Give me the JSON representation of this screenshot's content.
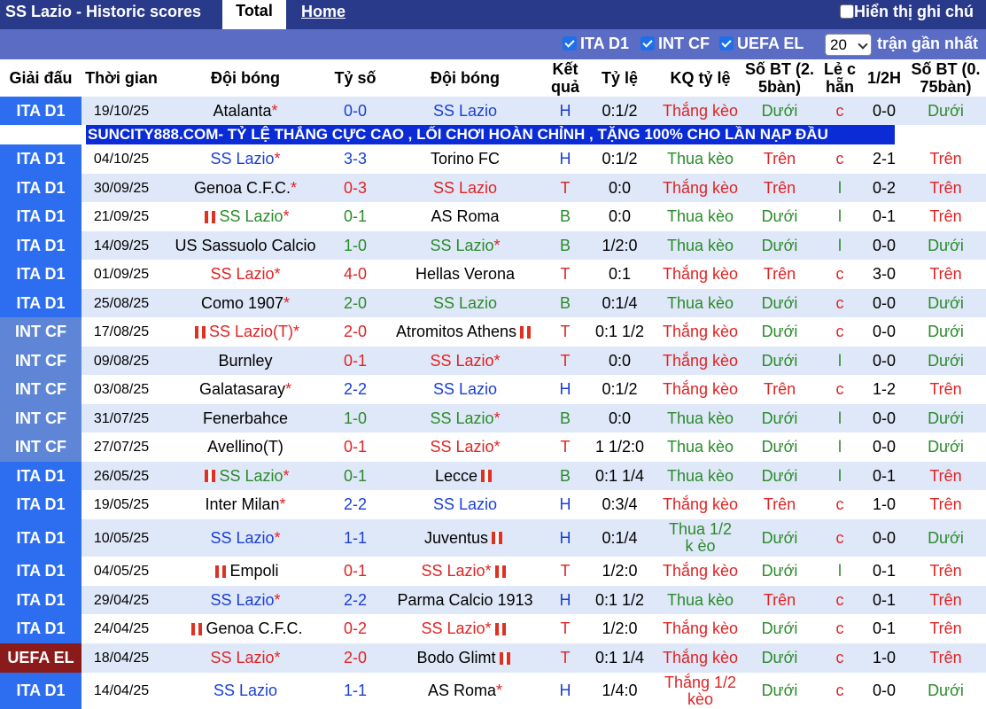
{
  "header": {
    "title": "SS Lazio - Historic scores",
    "tab_total": "Total",
    "tab_home": "Home",
    "show_all": "Hiển thị ghi chú"
  },
  "filters": {
    "ita": "ITA D1",
    "int": "INT CF",
    "uefa": "UEFA EL",
    "count": "20",
    "near": "trận gần nhất"
  },
  "columns": {
    "league": "Giải đấu",
    "time": "Thời gian",
    "home": "Đội bóng",
    "score": "Tỷ số",
    "away": "Đội bóng",
    "result": "Kết quả",
    "odds": "Tỷ lệ",
    "odds_result": "KQ tỷ lệ",
    "ou": "Số BT (2. 5bàn)",
    "oe": "Lẻ c hẵn",
    "half": "1/2H",
    "ou2": "Số BT (0. 75bàn)"
  },
  "ad": "SUNCITY888.COM- TỶ LỆ THẮNG CỰC CAO , LỐI CHƠI HOÀN CHỈNH , TẶNG 100% CHO LẦN NẠP ĐẦU",
  "colors": {
    "ita": "#2d6ef0",
    "int": "#5f86d6",
    "uefa": "#8b1a1a",
    "row_a": "#dfe8f8",
    "row_b": "#ffffff"
  },
  "rows": [
    {
      "league": "ITA D1",
      "time": "19/10/25",
      "home": "Atalanta",
      "home_star": "*",
      "home_c": "black",
      "score": "0-0",
      "sc_c": "blue",
      "away": "SS Lazio",
      "away_star": "",
      "away_c": "blue",
      "res": "H",
      "res_c": "blue",
      "odds": "0:1/2",
      "kq": "Thắng kèo",
      "kq_c": "red",
      "ou": "Dưới",
      "ou_c": "green",
      "oe": "c",
      "oe_c": "red",
      "half": "0-0",
      "ou2": "Dưới",
      "ou2_c": "green"
    },
    {
      "league": "ITA D1",
      "time": "04/10/25",
      "home": "SS Lazio",
      "home_star": "*",
      "home_c": "blue",
      "score": "3-3",
      "sc_c": "blue",
      "away": "Torino FC",
      "away_star": "",
      "away_c": "black",
      "res": "H",
      "res_c": "blue",
      "odds": "0:1/2",
      "kq": "Thua kèo",
      "kq_c": "green",
      "ou": "Trên",
      "ou_c": "red",
      "oe": "c",
      "oe_c": "red",
      "half": "2-1",
      "ou2": "Trên",
      "ou2_c": "red"
    },
    {
      "league": "ITA D1",
      "time": "30/09/25",
      "home": "Genoa C.F.C.",
      "home_star": "*",
      "home_c": "black",
      "score": "0-3",
      "sc_c": "red",
      "away": "SS Lazio",
      "away_star": "",
      "away_c": "red",
      "res": "T",
      "res_c": "red",
      "odds": "0:0",
      "kq": "Thắng kèo",
      "kq_c": "red",
      "ou": "Trên",
      "ou_c": "red",
      "oe": "l",
      "oe_c": "green",
      "half": "0-2",
      "ou2": "Trên",
      "ou2_c": "red"
    },
    {
      "league": "ITA D1",
      "time": "21/09/25",
      "home": "SS Lazio",
      "home_star": "*",
      "home_flag": true,
      "home_c": "green",
      "score": "0-1",
      "sc_c": "green",
      "away": "AS Roma",
      "away_star": "",
      "away_c": "black",
      "res": "B",
      "res_c": "green",
      "odds": "0:0",
      "kq": "Thua kèo",
      "kq_c": "green",
      "ou": "Dưới",
      "ou_c": "green",
      "oe": "l",
      "oe_c": "green",
      "half": "0-1",
      "ou2": "Trên",
      "ou2_c": "red"
    },
    {
      "league": "ITA D1",
      "time": "14/09/25",
      "home": "US Sassuolo Calcio",
      "home_star": "",
      "home_c": "black",
      "score": "1-0",
      "sc_c": "green",
      "away": "SS Lazio",
      "away_star": "*",
      "away_c": "green",
      "res": "B",
      "res_c": "green",
      "odds": "1/2:0",
      "kq": "Thua kèo",
      "kq_c": "green",
      "ou": "Dưới",
      "ou_c": "green",
      "oe": "l",
      "oe_c": "green",
      "half": "0-0",
      "ou2": "Dưới",
      "ou2_c": "green"
    },
    {
      "league": "ITA D1",
      "time": "01/09/25",
      "home": "SS Lazio",
      "home_star": "*",
      "home_c": "red",
      "score": "4-0",
      "sc_c": "red",
      "away": "Hellas Verona",
      "away_star": "",
      "away_c": "black",
      "res": "T",
      "res_c": "red",
      "odds": "0:1",
      "kq": "Thắng kèo",
      "kq_c": "red",
      "ou": "Trên",
      "ou_c": "red",
      "oe": "c",
      "oe_c": "red",
      "half": "3-0",
      "ou2": "Trên",
      "ou2_c": "red"
    },
    {
      "league": "ITA D1",
      "time": "25/08/25",
      "home": "Como 1907",
      "home_star": "*",
      "home_c": "black",
      "score": "2-0",
      "sc_c": "green",
      "away": "SS Lazio",
      "away_star": "",
      "away_c": "green",
      "res": "B",
      "res_c": "green",
      "odds": "0:1/4",
      "kq": "Thua kèo",
      "kq_c": "green",
      "ou": "Dưới",
      "ou_c": "green",
      "oe": "c",
      "oe_c": "red",
      "half": "0-0",
      "ou2": "Dưới",
      "ou2_c": "green"
    },
    {
      "league": "INT CF",
      "time": "17/08/25",
      "home": "SS Lazio(T)",
      "home_star": "*",
      "home_flag": true,
      "home_c": "red",
      "score": "2-0",
      "sc_c": "red",
      "away": "Atromitos Athens",
      "away_star": "",
      "away_flag": true,
      "away_c": "black",
      "res": "T",
      "res_c": "red",
      "odds": "0:1 1/2",
      "kq": "Thắng kèo",
      "kq_c": "red",
      "ou": "Dưới",
      "ou_c": "green",
      "oe": "c",
      "oe_c": "red",
      "half": "0-0",
      "ou2": "Dưới",
      "ou2_c": "green"
    },
    {
      "league": "INT CF",
      "time": "09/08/25",
      "home": "Burnley",
      "home_star": "",
      "home_c": "black",
      "score": "0-1",
      "sc_c": "red",
      "away": "SS Lazio",
      "away_star": "*",
      "away_c": "red",
      "res": "T",
      "res_c": "red",
      "odds": "0:0",
      "kq": "Thắng kèo",
      "kq_c": "red",
      "ou": "Dưới",
      "ou_c": "green",
      "oe": "l",
      "oe_c": "green",
      "half": "0-0",
      "ou2": "Dưới",
      "ou2_c": "green"
    },
    {
      "league": "INT CF",
      "time": "03/08/25",
      "home": "Galatasaray",
      "home_star": "*",
      "home_c": "black",
      "score": "2-2",
      "sc_c": "blue",
      "away": "SS Lazio",
      "away_star": "",
      "away_c": "blue",
      "res": "H",
      "res_c": "blue",
      "odds": "0:1/2",
      "kq": "Thắng kèo",
      "kq_c": "red",
      "ou": "Trên",
      "ou_c": "red",
      "oe": "c",
      "oe_c": "red",
      "half": "1-2",
      "ou2": "Trên",
      "ou2_c": "red"
    },
    {
      "league": "INT CF",
      "time": "31/07/25",
      "home": "Fenerbahce",
      "home_star": "",
      "home_c": "black",
      "score": "1-0",
      "sc_c": "green",
      "away": "SS Lazio",
      "away_star": "*",
      "away_c": "green",
      "res": "B",
      "res_c": "green",
      "odds": "0:0",
      "kq": "Thua kèo",
      "kq_c": "green",
      "ou": "Dưới",
      "ou_c": "green",
      "oe": "l",
      "oe_c": "green",
      "half": "0-0",
      "ou2": "Dưới",
      "ou2_c": "green"
    },
    {
      "league": "INT CF",
      "time": "27/07/25",
      "home": "Avellino(T)",
      "home_star": "",
      "home_c": "black",
      "score": "0-1",
      "sc_c": "red",
      "away": "SS Lazio",
      "away_star": "*",
      "away_c": "red",
      "res": "T",
      "res_c": "red",
      "odds": "1 1/2:0",
      "kq": "Thua kèo",
      "kq_c": "green",
      "ou": "Dưới",
      "ou_c": "green",
      "oe": "l",
      "oe_c": "green",
      "half": "0-0",
      "ou2": "Dưới",
      "ou2_c": "green"
    },
    {
      "league": "ITA D1",
      "time": "26/05/25",
      "home": "SS Lazio",
      "home_star": "*",
      "home_flag": true,
      "home_c": "green",
      "score": "0-1",
      "sc_c": "green",
      "away": "Lecce",
      "away_star": "",
      "away_flag": true,
      "away_c": "black",
      "res": "B",
      "res_c": "green",
      "odds": "0:1 1/4",
      "kq": "Thua kèo",
      "kq_c": "green",
      "ou": "Dưới",
      "ou_c": "green",
      "oe": "l",
      "oe_c": "green",
      "half": "0-1",
      "ou2": "Trên",
      "ou2_c": "red"
    },
    {
      "league": "ITA D1",
      "time": "19/05/25",
      "home": "Inter Milan",
      "home_star": "*",
      "home_c": "black",
      "score": "2-2",
      "sc_c": "blue",
      "away": "SS Lazio",
      "away_star": "",
      "away_c": "blue",
      "res": "H",
      "res_c": "blue",
      "odds": "0:3/4",
      "kq": "Thắng kèo",
      "kq_c": "red",
      "ou": "Trên",
      "ou_c": "red",
      "oe": "c",
      "oe_c": "red",
      "half": "1-0",
      "ou2": "Trên",
      "ou2_c": "red"
    },
    {
      "league": "ITA D1",
      "time": "10/05/25",
      "home": "SS Lazio",
      "home_star": "*",
      "home_c": "blue",
      "score": "1-1",
      "sc_c": "blue",
      "away": "Juventus",
      "away_star": "",
      "away_flag": true,
      "away_c": "black",
      "res": "H",
      "res_c": "blue",
      "odds": "0:1/4",
      "kq": "Thua 1/2 k èo",
      "kq_c": "green",
      "ou": "Dưới",
      "ou_c": "green",
      "oe": "c",
      "oe_c": "red",
      "half": "0-0",
      "ou2": "Dưới",
      "ou2_c": "green",
      "tall": true
    },
    {
      "league": "ITA D1",
      "time": "04/05/25",
      "home": "Empoli",
      "home_star": "",
      "home_flag": true,
      "home_c": "black",
      "score": "0-1",
      "sc_c": "red",
      "away": "SS Lazio",
      "away_star": "*",
      "away_flag": true,
      "away_c": "red",
      "res": "T",
      "res_c": "red",
      "odds": "1/2:0",
      "kq": "Thắng kèo",
      "kq_c": "red",
      "ou": "Dưới",
      "ou_c": "green",
      "oe": "l",
      "oe_c": "green",
      "half": "0-1",
      "ou2": "Trên",
      "ou2_c": "red"
    },
    {
      "league": "ITA D1",
      "time": "29/04/25",
      "home": "SS Lazio",
      "home_star": "*",
      "home_c": "blue",
      "score": "2-2",
      "sc_c": "blue",
      "away": "Parma Calcio 1913",
      "away_star": "",
      "away_c": "black",
      "res": "H",
      "res_c": "blue",
      "odds": "0:1 1/2",
      "kq": "Thua kèo",
      "kq_c": "green",
      "ou": "Trên",
      "ou_c": "red",
      "oe": "c",
      "oe_c": "red",
      "half": "0-1",
      "ou2": "Trên",
      "ou2_c": "red"
    },
    {
      "league": "ITA D1",
      "time": "24/04/25",
      "home": "Genoa C.F.C.",
      "home_star": "",
      "home_flag": true,
      "home_c": "black",
      "score": "0-2",
      "sc_c": "red",
      "away": "SS Lazio",
      "away_star": "*",
      "away_flag": true,
      "away_c": "red",
      "res": "T",
      "res_c": "red",
      "odds": "1/2:0",
      "kq": "Thắng kèo",
      "kq_c": "red",
      "ou": "Dưới",
      "ou_c": "green",
      "oe": "c",
      "oe_c": "red",
      "half": "0-1",
      "ou2": "Trên",
      "ou2_c": "red"
    },
    {
      "league": "UEFA EL",
      "time": "18/04/25",
      "home": "SS Lazio",
      "home_star": "*",
      "home_c": "red",
      "score": "2-0",
      "sc_c": "red",
      "away": "Bodo Glimt",
      "away_star": "",
      "away_flag": true,
      "away_c": "black",
      "res": "T",
      "res_c": "red",
      "odds": "0:1 1/4",
      "kq": "Thắng kèo",
      "kq_c": "red",
      "ou": "Dưới",
      "ou_c": "green",
      "oe": "c",
      "oe_c": "red",
      "half": "1-0",
      "ou2": "Trên",
      "ou2_c": "red"
    },
    {
      "league": "ITA D1",
      "time": "14/04/25",
      "home": "SS Lazio",
      "home_star": "",
      "home_c": "blue",
      "score": "1-1",
      "sc_c": "blue",
      "away": "AS Roma",
      "away_star": "*",
      "away_c": "black",
      "res": "H",
      "res_c": "blue",
      "odds": "1/4:0",
      "kq": "Thắng 1/2 kèo",
      "kq_c": "red",
      "ou": "Dưới",
      "ou_c": "green",
      "oe": "c",
      "oe_c": "red",
      "half": "0-0",
      "ou2": "Dưới",
      "ou2_c": "green",
      "tall": true
    }
  ]
}
